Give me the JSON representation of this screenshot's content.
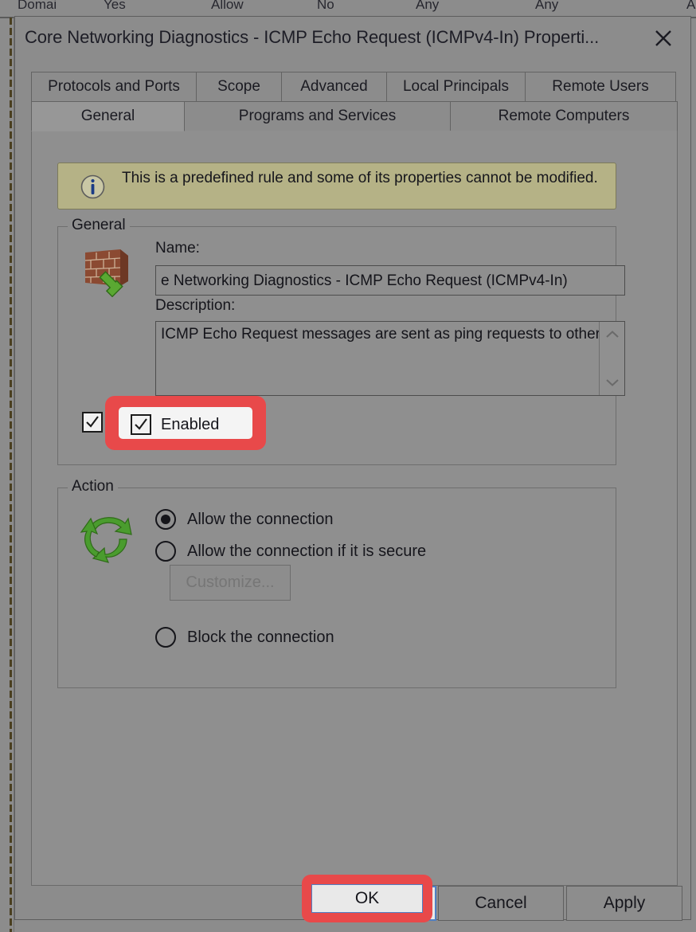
{
  "background": {
    "row_cells": [
      "Domai",
      "Yes",
      "Allow",
      "No",
      "Any",
      "Any",
      "A"
    ]
  },
  "dialog": {
    "title": "Core Networking Diagnostics - ICMP Echo Request (ICMPv4-In) Properti...",
    "close_icon": "close-icon"
  },
  "tabs": {
    "row1": [
      {
        "label": "Protocols and Ports",
        "selected": false
      },
      {
        "label": "Scope",
        "selected": false
      },
      {
        "label": "Advanced",
        "selected": false
      },
      {
        "label": "Local Principals",
        "selected": false
      },
      {
        "label": "Remote Users",
        "selected": false
      }
    ],
    "row2": [
      {
        "label": "General",
        "selected": true
      },
      {
        "label": "Programs and Services",
        "selected": false
      },
      {
        "label": "Remote Computers",
        "selected": false
      }
    ]
  },
  "info_banner": {
    "icon": "info-icon",
    "text": "This is a predefined rule and some of its properties cannot be modified.",
    "background_color": "#b5b286"
  },
  "general_group": {
    "title": "General",
    "icon": "firewall-brick-wall-icon",
    "name_label": "Name:",
    "name_value": "e Networking Diagnostics - ICMP Echo Request (ICMPv4-In)",
    "description_label": "Description:",
    "description_value": "ICMP Echo Request messages are sent as ping requests to other nodes.",
    "enabled_label": "Enabled",
    "enabled_checked": true,
    "scroll_up_icon": "chevron-up-icon",
    "scroll_down_icon": "chevron-down-icon"
  },
  "action_group": {
    "title": "Action",
    "icon": "green-recycle-arrows-icon",
    "options": [
      {
        "label": "Allow the connection",
        "selected": true
      },
      {
        "label": "Allow the connection if it is secure",
        "selected": false
      },
      {
        "label": "Block the connection",
        "selected": false
      }
    ],
    "customize_label": "Customize...",
    "customize_disabled": true
  },
  "buttons": {
    "ok": "OK",
    "cancel": "Cancel",
    "apply": "Apply"
  },
  "highlights": {
    "color": "#e8494a",
    "targets": [
      "enabled-checkbox",
      "ok-button"
    ]
  }
}
